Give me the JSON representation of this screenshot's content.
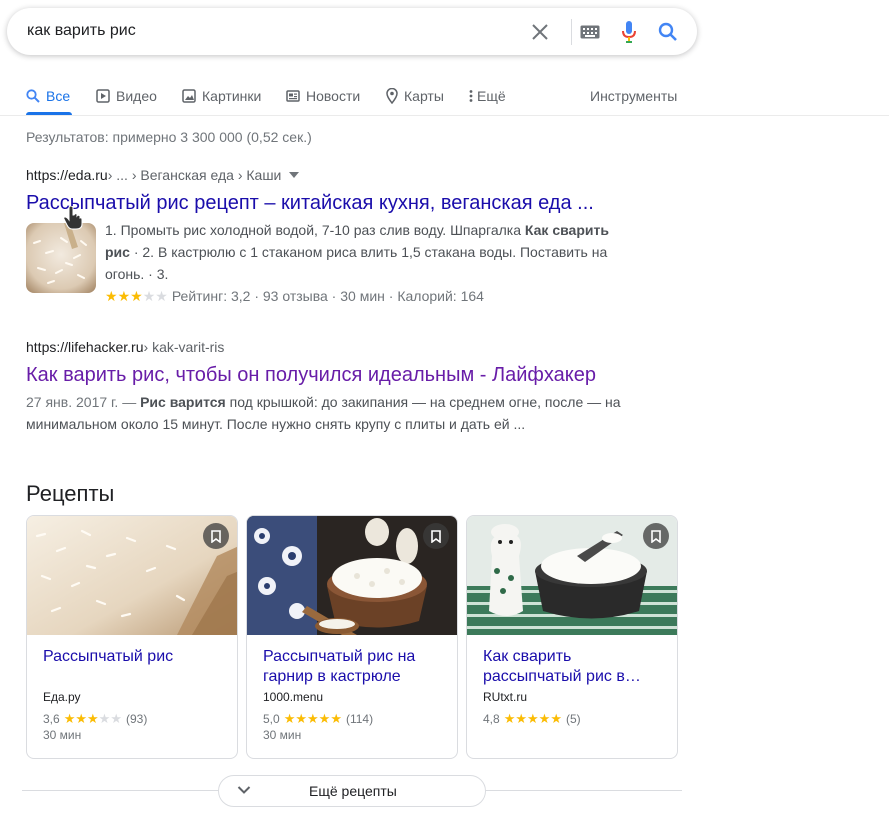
{
  "search": {
    "query": "как варить рис"
  },
  "tabs": [
    {
      "label": "Все",
      "icon": "search-icon",
      "active": true
    },
    {
      "label": "Видео",
      "icon": "video-icon"
    },
    {
      "label": "Картинки",
      "icon": "image-icon"
    },
    {
      "label": "Новости",
      "icon": "news-icon"
    },
    {
      "label": "Карты",
      "icon": "map-pin-icon"
    },
    {
      "label": "Ещё",
      "icon": "more-vert-icon"
    }
  ],
  "tools_label": "Инструменты",
  "stats": "Результатов: примерно 3 300 000 (0,52 сек.)",
  "results": [
    {
      "url": "https://eda.ru",
      "breadcrumb": " › ... › Веганская еда › Каши",
      "title": "Рассыпчатый рис рецепт – китайская кухня, веганская еда ...",
      "snippet_a": "1. Промыть рис холодной водой, 7-10 раз слив воду. Шпаргалка ",
      "snippet_bold": "Как сварить рис",
      "snippet_b": " · 2. В кастрюлю с 1 стаканом риса влить 1,5 стакана воды. Поставить на огонь. · 3.",
      "rating_text": "Рейтинг: 3,2 · 93 отзыва · 30 мин · Калорий: 164",
      "rating_value": 3.2
    },
    {
      "url": "https://lifehacker.ru",
      "breadcrumb": " › kak-varit-ris",
      "title": "Как варить рис, чтобы он получился идеальным - Лайфхакер",
      "date": "27 янв. 2017 г. — ",
      "snippet_bold": "Рис варится",
      "snippet_b": " под крышкой: до закипания — на среднем огне, после — на минимальном около 15 минут. После нужно снять крупу с плиты и дать ей ..."
    }
  ],
  "recipes": {
    "title": "Рецепты",
    "cards": [
      {
        "title": "Рассыпчатый рис",
        "source": "Еда.ру",
        "rating": "3,6",
        "rating_value": 3.6,
        "reviews": "(93)",
        "time": "30 мин"
      },
      {
        "title": "Рассыпчатый рис на гарнир в кастрюле",
        "source": "1000.menu",
        "rating": "5,0",
        "rating_value": 5.0,
        "reviews": "(114)",
        "time": "30 мин"
      },
      {
        "title": "Как сварить рассыпчатый рис в…",
        "source": "RUtxt.ru",
        "rating": "4,8",
        "rating_value": 4.8,
        "reviews": "(5)",
        "time": ""
      }
    ],
    "more_label": "Ещё рецепты"
  },
  "colors": {
    "link": "#1a0dab",
    "visited": "#681da8",
    "accent": "#1a73e8",
    "star": "#fbbc04"
  }
}
